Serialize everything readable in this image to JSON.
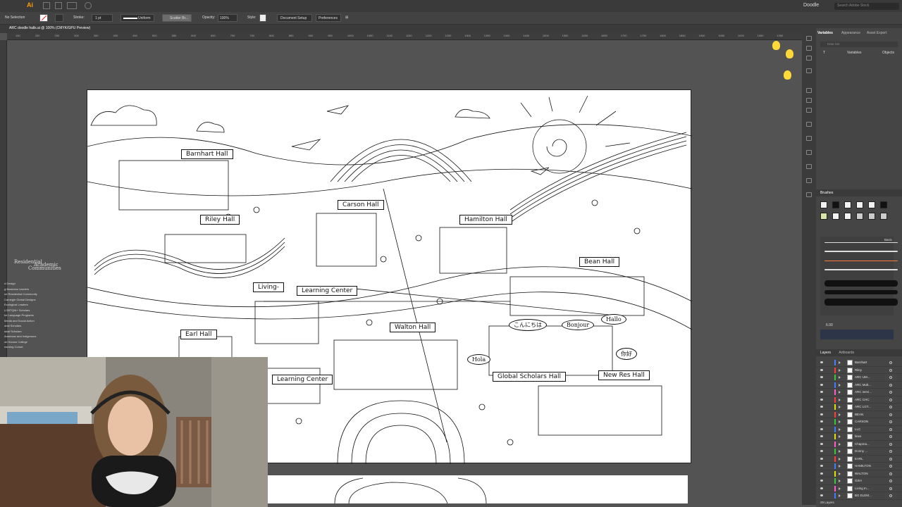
{
  "app": {
    "logo": "Ai",
    "workspace": "Doodle",
    "search_placeholder": "Search Adobe Stock"
  },
  "control_bar": {
    "selection": "No Selection",
    "stroke_label": "Stroke:",
    "stroke_value": "1 pt",
    "stroke_profile": "Uniform",
    "brush": "Scatter Br...",
    "opacity_label": "Opacity:",
    "opacity_value": "100%",
    "style_label": "Style:",
    "document_setup": "Document Setup",
    "preferences": "Preferences"
  },
  "document": {
    "tab_title": "ARC doodle halls.ai @ 100% (CMYK/GPU Preview)"
  },
  "ruler": {
    "ticks": [
      "150",
      "200",
      "250",
      "300",
      "350",
      "400",
      "450",
      "500",
      "550",
      "600",
      "650",
      "700",
      "750",
      "800",
      "850",
      "900",
      "950",
      "1000",
      "1050",
      "1100",
      "1150",
      "1200",
      "1250",
      "1300",
      "1350",
      "1400",
      "1450",
      "1500",
      "1550",
      "1600",
      "1650",
      "1700",
      "1750",
      "1800",
      "1850",
      "1900",
      "1950",
      "1000",
      "1050",
      "1350"
    ]
  },
  "panels": {
    "top_tabs": [
      "Variables",
      "Appearance",
      "Asset Export"
    ],
    "data_set": "Data Set",
    "variables_col": "Variables",
    "objects_col": "Objects",
    "brushes_title": "Brushes",
    "brush_library_label": "Basic",
    "brush_size": "6.00",
    "layers_tabs": [
      "Layers",
      "Artboards"
    ],
    "layers_count": "29 Layers",
    "layers": [
      {
        "name": "Barnhart",
        "color": "#4f7cff"
      },
      {
        "name": "Riley",
        "color": "#ff3b3b"
      },
      {
        "name": "ARC UM...",
        "color": "#37c837"
      },
      {
        "name": "ARC Mult...",
        "color": "#3f7bff"
      },
      {
        "name": "ARC servi...",
        "color": "#ff5ac8"
      },
      {
        "name": "ARC CHC",
        "color": "#ff3b3b"
      },
      {
        "name": "ARC LGT...",
        "color": "#e0e000"
      },
      {
        "name": "BEAN",
        "color": "#ff3b3b"
      },
      {
        "name": "CARSON",
        "color": "#37c837"
      },
      {
        "name": "LLC",
        "color": "#3f7bff"
      },
      {
        "name": "lines",
        "color": "#e0e000"
      },
      {
        "name": "Chapma...",
        "color": "#ff5ac8"
      },
      {
        "name": "Donny ...",
        "color": "#37c837"
      },
      {
        "name": "EARL",
        "color": "#ff3b3b"
      },
      {
        "name": "HAMILTON",
        "color": "#3f7bff"
      },
      {
        "name": "WALTON",
        "color": "#e0e000"
      },
      {
        "name": "GSH",
        "color": "#37c837"
      },
      {
        "name": "Living In...",
        "color": "#ff5ac8"
      },
      {
        "name": "BG ELEM...",
        "color": "#3f7bff"
      }
    ]
  },
  "artwork": {
    "labels": {
      "barnhart": "Barnhart Hall",
      "carson": "Carson Hall",
      "riley": "Riley Hall",
      "hamilton": "Hamilton Hall",
      "bean": "Bean Hall",
      "living": "Living-",
      "learning_center_1": "Learning Center",
      "earl": "Earl Hall",
      "walton": "Walton Hall",
      "learning_center_2": "Learning Center",
      "global_scholars": "Global Scholars Hall",
      "new_res": "New Res Hall"
    },
    "greetings": {
      "konnichiwa": "こんにちは",
      "bonjour": "Bonjour",
      "hallo": "Hallo",
      "hola": "Hola",
      "nihao": "你好"
    }
  },
  "sidebar_text": {
    "residential": "Residential",
    "academic": "Academic",
    "communities": "Communities",
    "items": [
      "d Design",
      "g Business Leaders",
      "ne Residential Community",
      "Carnegie Global Designs",
      "Ecological Leaders",
      "LGBTQIA+ Scholars",
      "he Language Programs",
      "Media and Social Action",
      "obal Scholars",
      "sical Scholars",
      "American and Indigenous",
      "ok Honors College",
      "earning Cohort"
    ]
  }
}
